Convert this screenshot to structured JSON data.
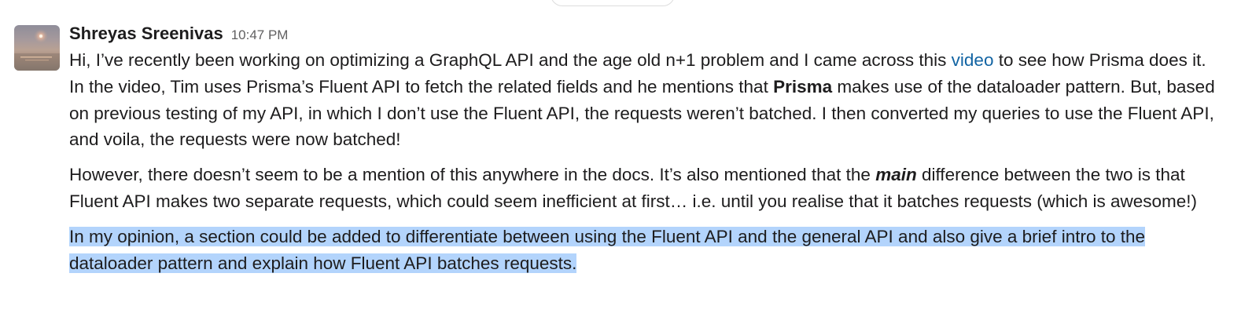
{
  "message": {
    "sender": "Shreyas Sreenivas",
    "timestamp": "10:47 PM",
    "avatar": "sunset-photo-avatar",
    "paragraphs": {
      "p1": {
        "before_link": "Hi, I’ve recently been working on optimizing a GraphQL API and the age old n+1 problem and I came across this ",
        "link": "video",
        "after_link": " to see how Prisma does it. In the video, Tim uses Prisma’s Fluent API to fetch the related fields and he mentions that ",
        "bold": "Prisma",
        "after_bold": " makes use of the dataloader pattern. But, based on previous testing of my API, in which I don’t use the Fluent API, the requests weren’t batched. I then converted my queries to use the Fluent API, and voila, the requests were now batched!"
      },
      "p2": {
        "before_emphasis": "However, there doesn’t seem to be a mention of this anywhere in the docs. It’s also mentioned that the ",
        "emphasis": "main",
        "after_emphasis": " difference between the two is that Fluent API makes two separate requests, which could seem inefficient at first… i.e. until you realise that it batches requests (which is awesome!)"
      },
      "p3": {
        "text": "In my opinion, a section could be added to differentiate between using the Fluent API and the general API and also give a brief intro to the dataloader pattern and explain how Fluent API batches requests."
      }
    }
  },
  "colors": {
    "link": "#1264a3",
    "selection": "#b3d4fc",
    "text": "#1d1c1d",
    "timestamp": "#616061"
  }
}
